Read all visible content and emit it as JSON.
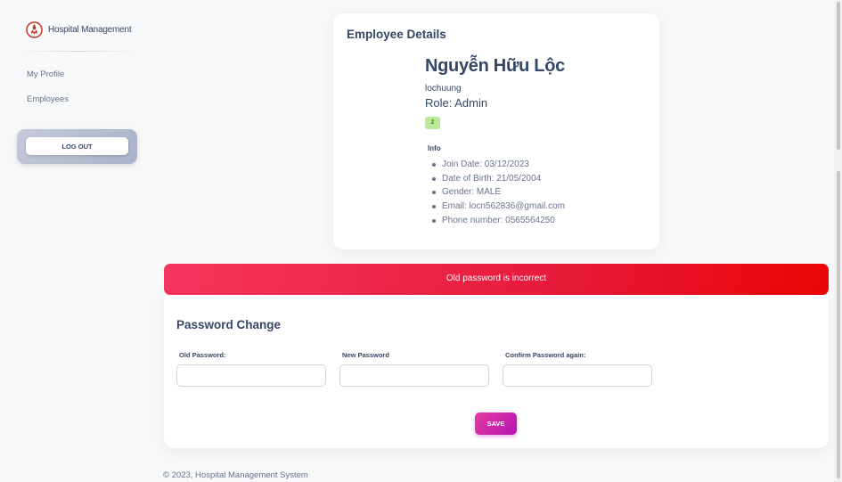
{
  "sidebar": {
    "brand": "Hospital Management",
    "items": [
      {
        "label": "My Profile"
      },
      {
        "label": "Employees"
      }
    ],
    "logout_label": "LOG OUT"
  },
  "employee": {
    "card_title": "Employee Details",
    "name": "Nguyễn Hữu Lộc",
    "username": "lochuung",
    "role": "Role: Admin",
    "badge": "2",
    "info_label": "Info",
    "info": [
      "Join Date: 03/12/2023",
      "Date of Birth: 21/05/2004",
      "Gender: MALE",
      "Email: locn562836@gmail.com",
      "Phone number: 0565564250"
    ]
  },
  "alert": {
    "message": "Old password is incorrect"
  },
  "password_form": {
    "title": "Password Change",
    "old_label": "Old Password:",
    "old_value": "",
    "new_label": "New Password",
    "new_value": "",
    "confirm_label": "Confirm Password again:",
    "confirm_value": "",
    "save_label": "SAVE"
  },
  "footer": {
    "text": "© 2023, Hospital Management System"
  },
  "colors": {
    "alert": "#f5365c",
    "save": "#cb0c9f",
    "badge": "#bce999",
    "text": "#344767"
  },
  "icons": {
    "brand": "hospital-logo-icon"
  }
}
